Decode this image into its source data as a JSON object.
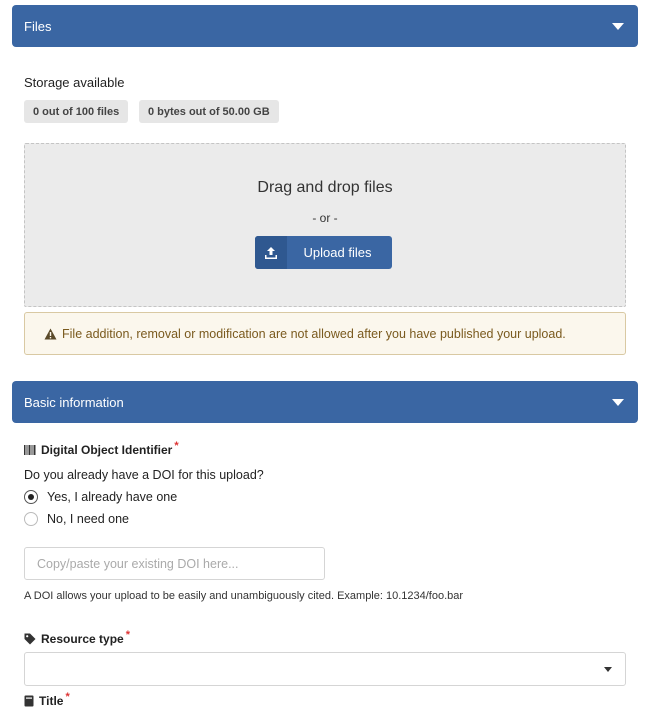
{
  "files_section": {
    "title": "Files",
    "storage_label": "Storage available",
    "files_badge": "0 out of 100 files",
    "bytes_badge": "0 bytes out of 50.00 GB",
    "dropzone_title": "Drag and drop files",
    "dropzone_or": "- or -",
    "upload_button": "Upload files",
    "warning": "File addition, removal or modification are not allowed after you have published your upload."
  },
  "basic_section": {
    "title": "Basic information",
    "doi": {
      "label": "Digital Object Identifier",
      "required_mark": "*",
      "question": "Do you already have a DOI for this upload?",
      "options": [
        {
          "label": "Yes, I already have one",
          "checked": true
        },
        {
          "label": "No, I need one",
          "checked": false
        }
      ],
      "input_placeholder": "Copy/paste your existing DOI here...",
      "input_value": "",
      "help": "A DOI allows your upload to be easily and unambiguously cited. Example: 10.1234/foo.bar"
    },
    "resource_type": {
      "label": "Resource type",
      "required_mark": "*",
      "selected": ""
    },
    "title_field": {
      "label": "Title",
      "required_mark": "*"
    }
  },
  "colors": {
    "header_bg": "#3a66a3",
    "warning_bg": "#fbf7ed",
    "required": "#dd3333"
  }
}
